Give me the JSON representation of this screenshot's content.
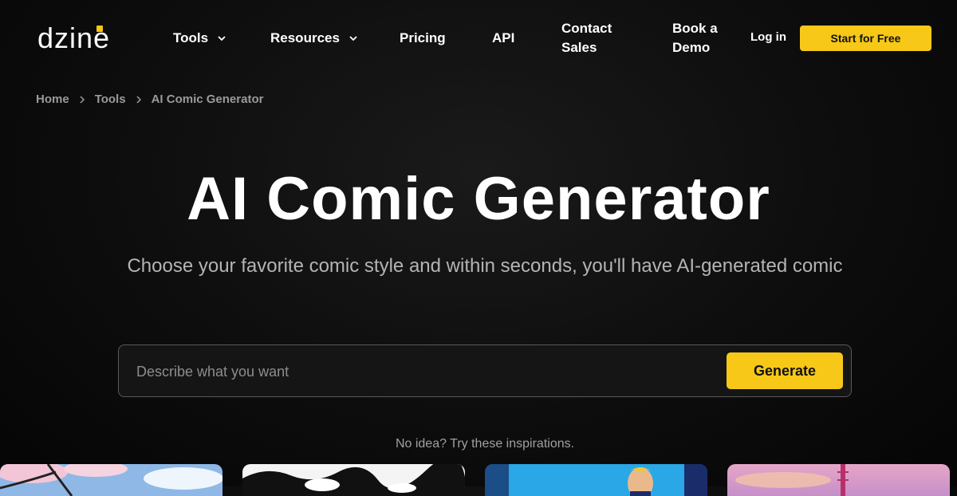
{
  "brand": {
    "logo_text": "dzine",
    "accent": "#f7c817"
  },
  "nav": {
    "items": [
      {
        "label": "Tools",
        "has_dropdown": true
      },
      {
        "label": "Resources",
        "has_dropdown": true
      },
      {
        "label": "Pricing",
        "has_dropdown": false
      },
      {
        "label": "API",
        "has_dropdown": false
      },
      {
        "label_line1": "Contact",
        "label_line2": "Sales"
      },
      {
        "label_line1": "Book a",
        "label_line2": "Demo"
      }
    ],
    "login_label": "Log in",
    "start_label": "Start for Free"
  },
  "breadcrumb": {
    "items": [
      "Home",
      "Tools",
      "AI Comic Generator"
    ]
  },
  "hero": {
    "title": "AI Comic Generator",
    "subtitle": "Choose your favorite comic style and within seconds, you'll have AI-generated comic"
  },
  "search": {
    "placeholder": "Describe what you want",
    "value": "",
    "button_label": "Generate"
  },
  "inspiration": {
    "text": "No idea? Try these inspirations."
  },
  "thumbnails": [
    {
      "name": "cherry-blossom-comic"
    },
    {
      "name": "black-white-ink-comic"
    },
    {
      "name": "superhero-comic"
    },
    {
      "name": "sunset-fantasy-comic"
    }
  ]
}
